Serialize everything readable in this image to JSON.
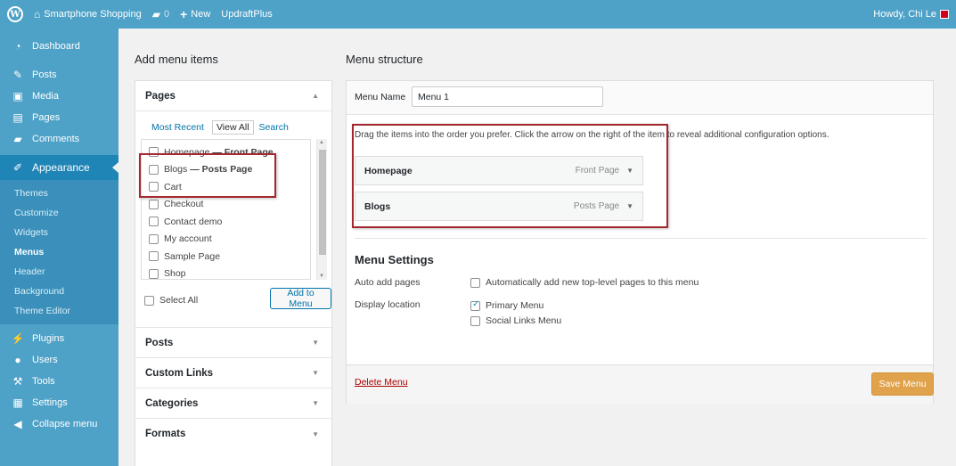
{
  "adminbar": {
    "site_name": "Smartphone Shopping",
    "comments_count": "0",
    "new_label": "New",
    "plugin_label": "UpdraftPlus",
    "greeting": "Howdy, Chi Le"
  },
  "sidebar": {
    "dashboard": "Dashboard",
    "posts": "Posts",
    "media": "Media",
    "pages": "Pages",
    "comments": "Comments",
    "appearance": "Appearance",
    "sub": [
      "Themes",
      "Customize",
      "Widgets",
      "Menus",
      "Header",
      "Background",
      "Theme Editor"
    ],
    "plugins": "Plugins",
    "users": "Users",
    "tools": "Tools",
    "settings": "Settings",
    "collapse": "Collapse menu"
  },
  "add_items": {
    "title": "Add menu items",
    "pages_heading": "Pages",
    "tabs": [
      "Most Recent",
      "View All",
      "Search"
    ],
    "pages": [
      {
        "name": "Homepage",
        "suffix": "— Front Page"
      },
      {
        "name": "Blogs",
        "suffix": "— Posts Page"
      },
      {
        "name": "Cart",
        "suffix": ""
      },
      {
        "name": "Checkout",
        "suffix": ""
      },
      {
        "name": "Contact demo",
        "suffix": ""
      },
      {
        "name": "My account",
        "suffix": ""
      },
      {
        "name": "Sample Page",
        "suffix": ""
      },
      {
        "name": "Shop",
        "suffix": ""
      }
    ],
    "select_all": "Select All",
    "add_button": "Add to Menu",
    "posts_heading": "Posts",
    "custom_links_heading": "Custom Links",
    "categories_heading": "Categories",
    "formats_heading": "Formats"
  },
  "structure": {
    "title": "Menu structure",
    "menu_name_label": "Menu Name",
    "menu_name_value": "Menu 1",
    "instructions": "Drag the items into the order you prefer. Click the arrow on the right of the item to reveal additional configuration options.",
    "items": [
      {
        "title": "Homepage",
        "type": "Front Page"
      },
      {
        "title": "Blogs",
        "type": "Posts Page"
      }
    ],
    "settings_title": "Menu Settings",
    "auto_add_label": "Auto add pages",
    "auto_add_option": "Automatically add new top-level pages to this menu",
    "display_location_label": "Display location",
    "primary_menu": "Primary Menu",
    "primary_menu_checked": true,
    "social_menu": "Social Links Menu",
    "delete_link": "Delete Menu",
    "save_button": "Save Menu"
  },
  "colors": {
    "sidebar": "#4ea1c7",
    "sidebar_active": "#1f84b6",
    "save_button": "#e0a24a",
    "highlight_box": "#a4282e",
    "link": "#0073aa"
  }
}
